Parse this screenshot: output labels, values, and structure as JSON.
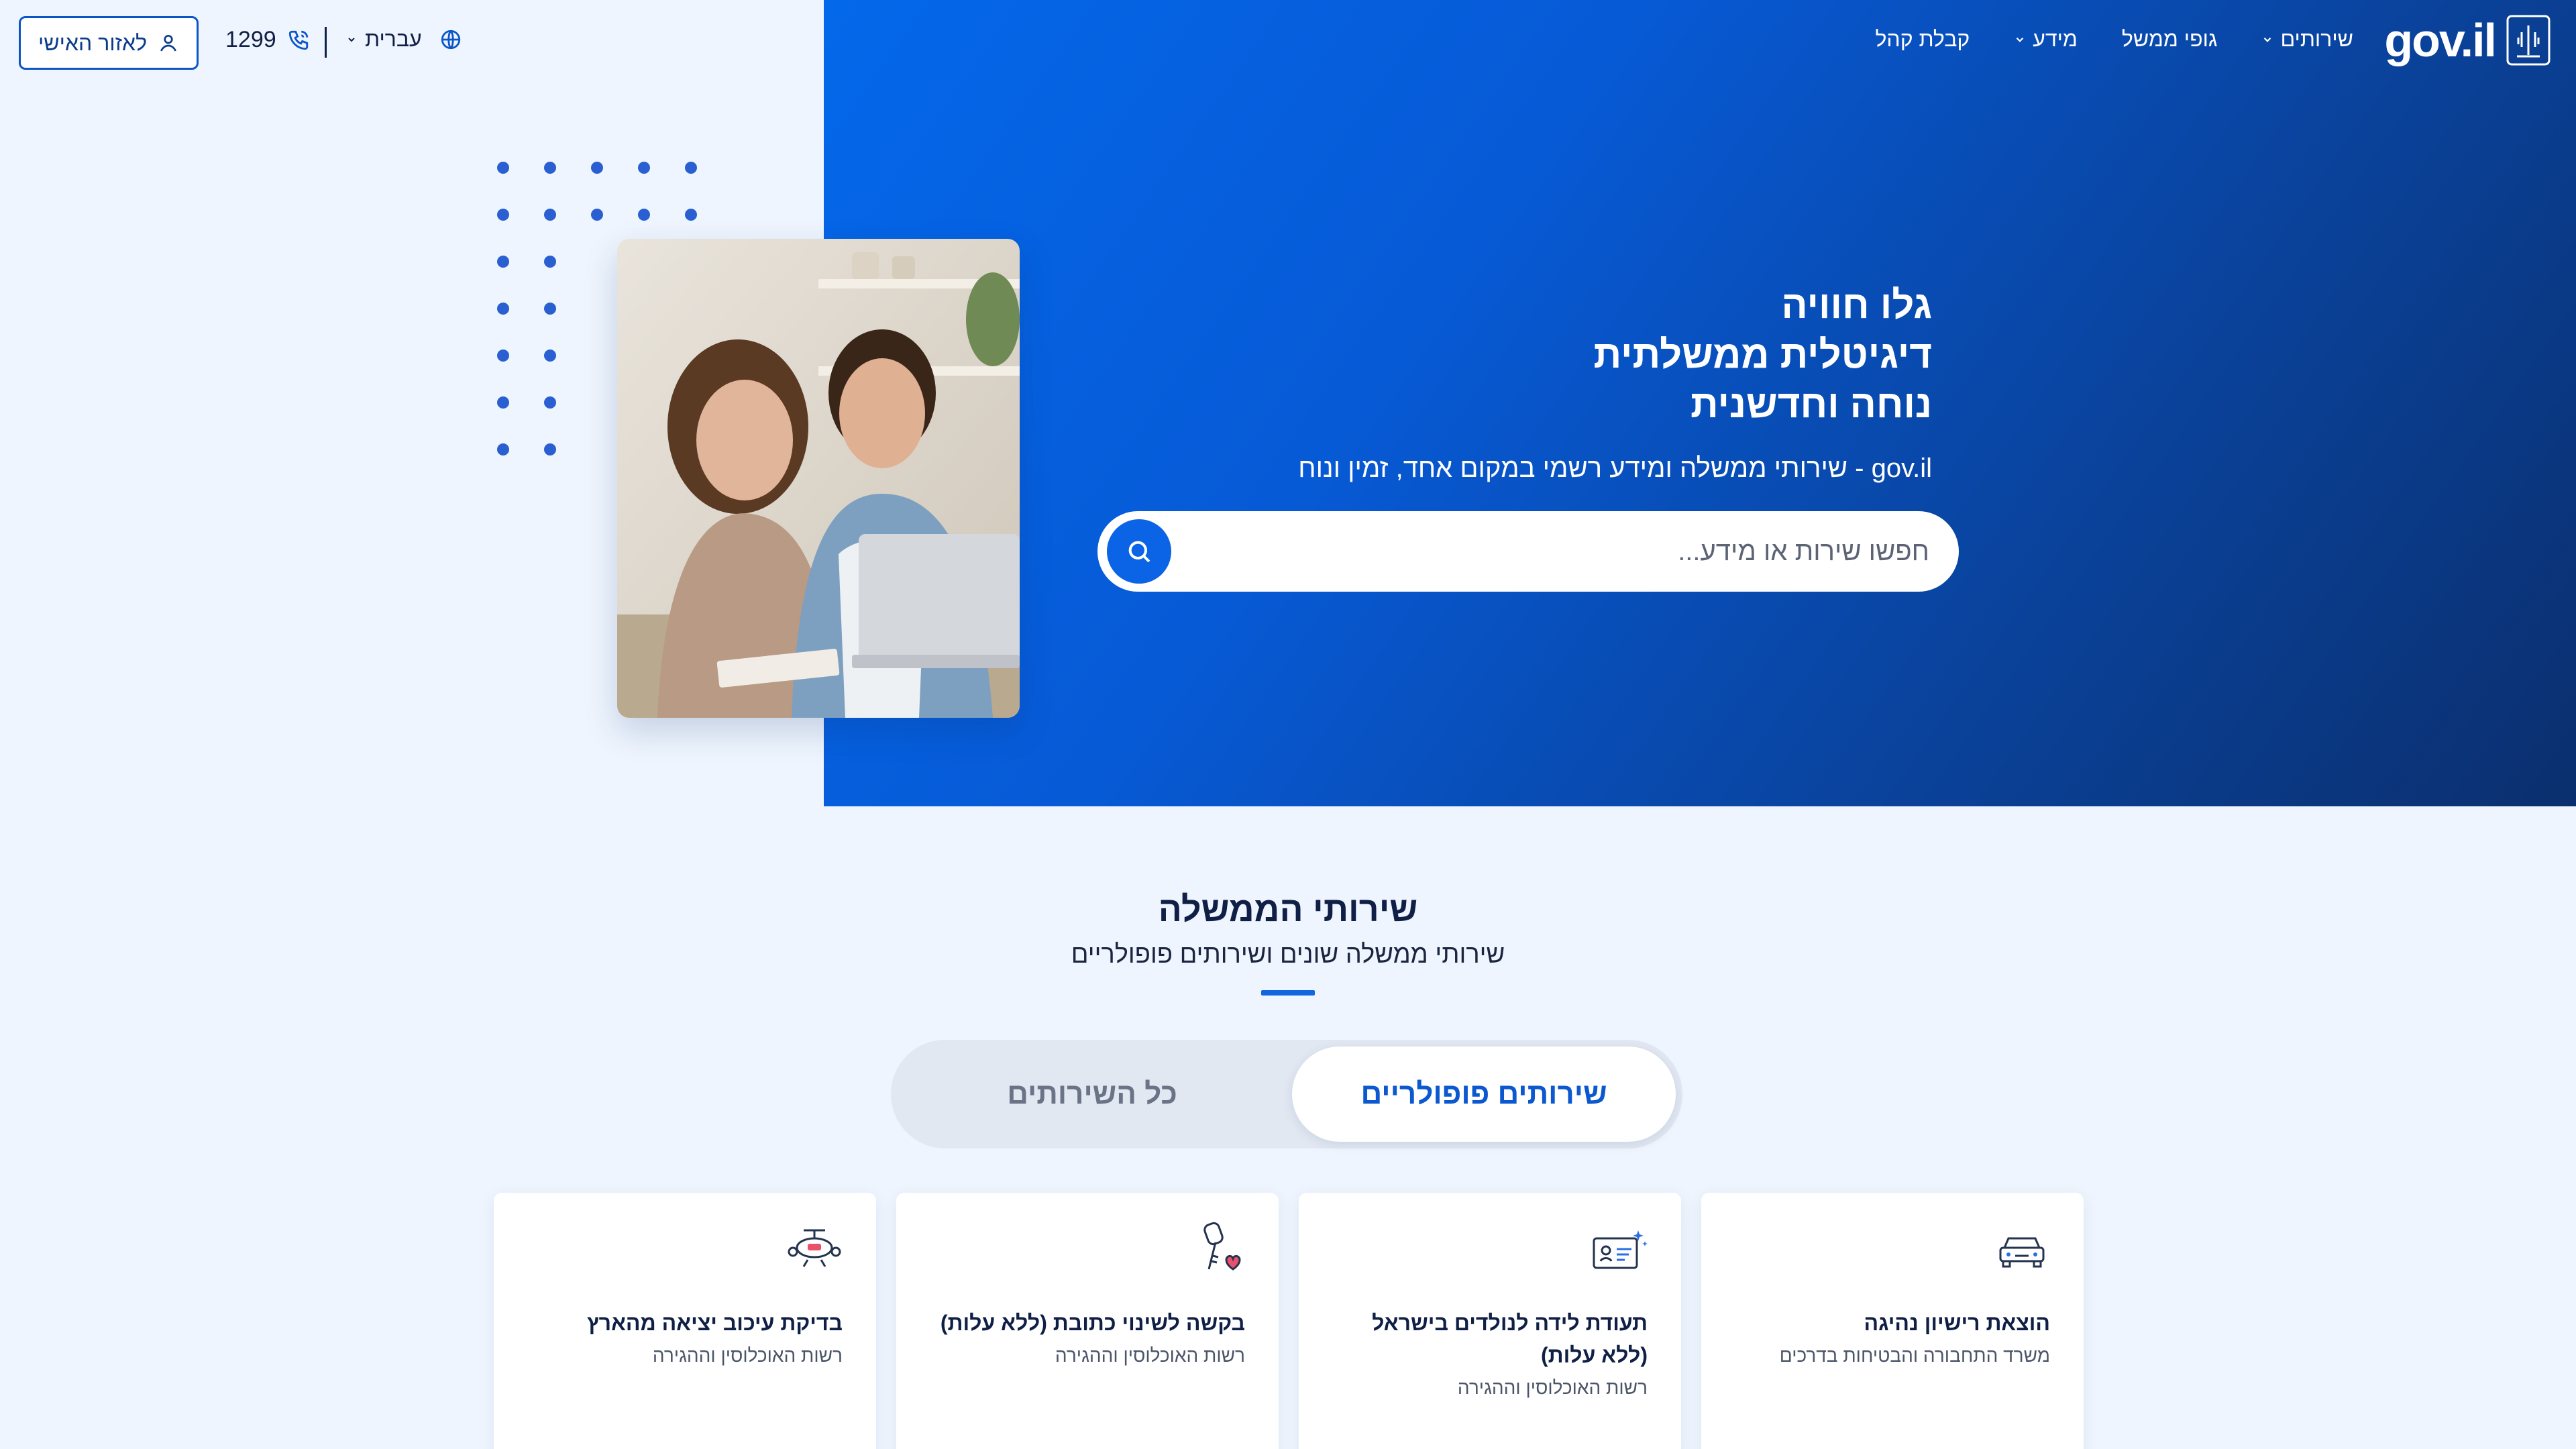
{
  "header": {
    "logo_text": "gov.il",
    "login_label": "לאזור האישי",
    "phone": "1299",
    "language": "עברית",
    "nav": [
      {
        "label": "שירותים",
        "dropdown": true
      },
      {
        "label": "גופי ממשל",
        "dropdown": false
      },
      {
        "label": "מידע",
        "dropdown": true
      },
      {
        "label": "קבלת קהל",
        "dropdown": false
      }
    ]
  },
  "hero": {
    "title_line1": "גלו חוויה",
    "title_line2": "דיגיטלית ממשלתית",
    "title_line3": "נוחה וחדשנית",
    "subtitle": "gov.il - שירותי ממשלה ומידע רשמי במקום אחד, זמין ונוח",
    "search_placeholder": "חפשו שירות או מידע..."
  },
  "services": {
    "title": "שירותי הממשלה",
    "subtitle": "שירותי ממשלה שונים ושירותים פופולריים",
    "tab_popular": "שירותים פופולריים",
    "tab_all": "כל השירותים",
    "cards": [
      {
        "title": "הוצאת רישיון נהיגה",
        "org": "משרד התחבורה והבטיחות בדרכים",
        "icon": "car-icon"
      },
      {
        "title": "תעודת לידה לנולדים בישראל (ללא עלות)",
        "org": "רשות האוכלוסין וההגירה",
        "icon": "id-card-icon"
      },
      {
        "title": "בקשה לשינוי כתובת (ללא עלות)",
        "org": "רשות האוכלוסין וההגירה",
        "icon": "house-key-icon"
      },
      {
        "title": "בדיקת עיכוב יציאה מהארץ",
        "org": "רשות האוכלוסין וההגירה",
        "icon": "airplane-icon"
      }
    ]
  },
  "colors": {
    "primary": "#0b63e6",
    "hero_dark": "#0b2f6e",
    "background": "#eef5fe"
  }
}
